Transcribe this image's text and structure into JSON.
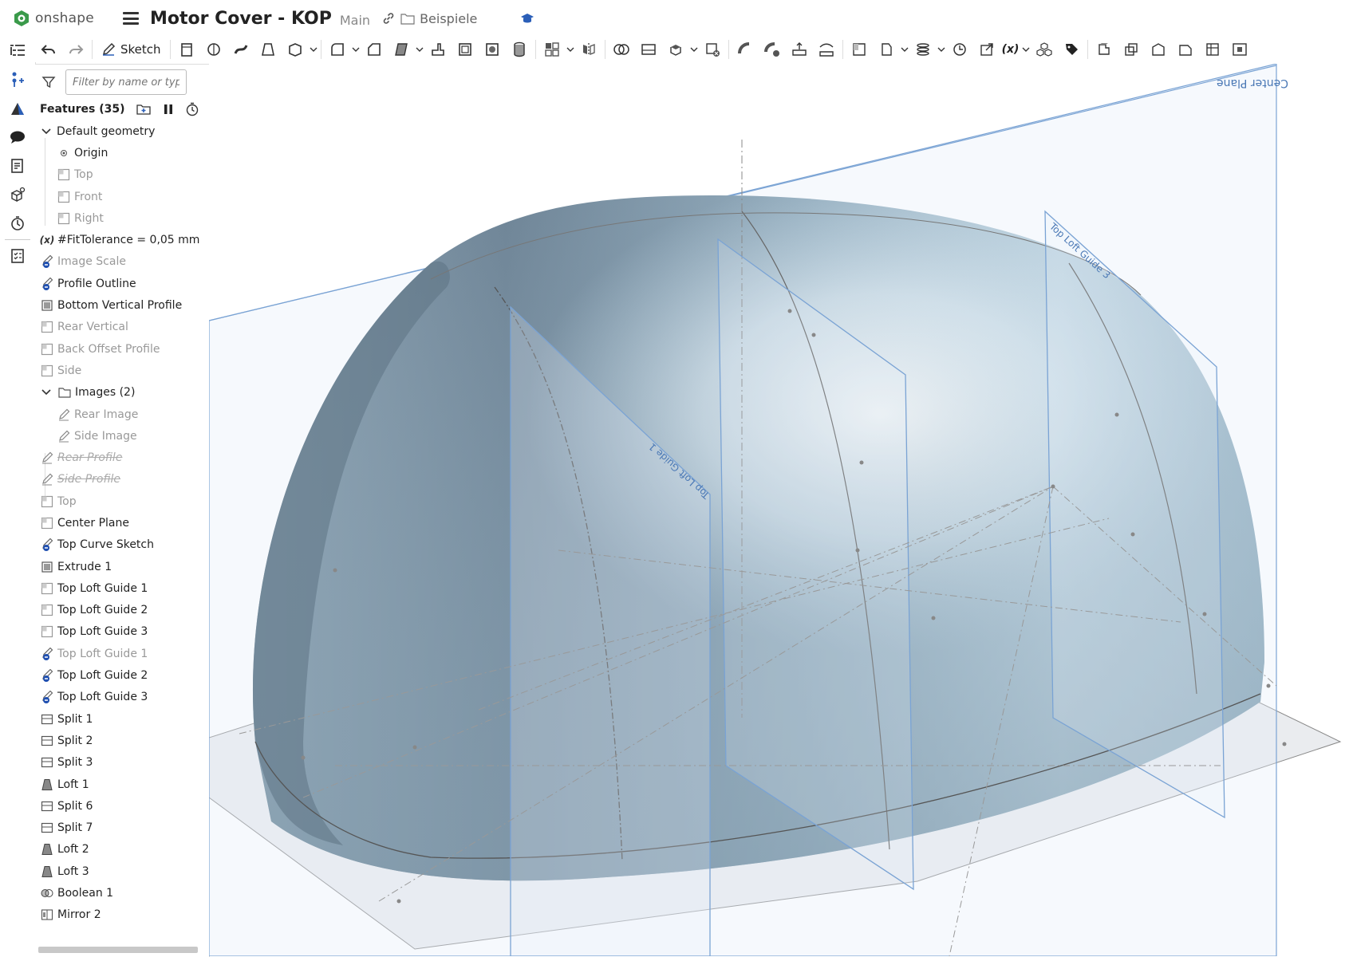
{
  "app": {
    "brand": "onshape",
    "document_title": "Motor Cover - KOP",
    "branch": "Main",
    "folder": "Beispiele"
  },
  "left_sidebar_icons": [
    "feature-list-icon",
    "insert-icon",
    "render-icon",
    "comment-icon",
    "notes-icon",
    "parts-icon",
    "history-icon",
    "properties-icon"
  ],
  "toolbar": {
    "sketch_label": "Sketch",
    "variable_label": "(x)"
  },
  "feature_panel": {
    "filter_placeholder": "Filter by name or type",
    "title": "Features (35)",
    "items": [
      {
        "label": "Default geometry",
        "type": "group",
        "icon": "chevron-down-icon"
      },
      {
        "label": "Origin",
        "type": "origin",
        "sub": true
      },
      {
        "label": "Top",
        "type": "plane",
        "sub": true,
        "grey": true
      },
      {
        "label": "Front",
        "type": "plane",
        "sub": true,
        "grey": true
      },
      {
        "label": "Right",
        "type": "plane",
        "sub": true,
        "grey": true
      },
      {
        "label": "#FitTolerance = 0,05 mm",
        "type": "variable"
      },
      {
        "label": "Image Scale",
        "type": "sketch-err",
        "grey": true
      },
      {
        "label": "Profile Outline",
        "type": "sketch-err"
      },
      {
        "label": "Bottom Vertical Profile",
        "type": "extrude"
      },
      {
        "label": "Rear Vertical",
        "type": "plane",
        "grey": true
      },
      {
        "label": "Back Offset Profile",
        "type": "plane",
        "grey": true
      },
      {
        "label": "Side",
        "type": "plane",
        "grey": true
      },
      {
        "label": "Images (2)",
        "type": "folder"
      },
      {
        "label": "Rear Image",
        "type": "sketch",
        "sub": true,
        "grey": true
      },
      {
        "label": "Side Image",
        "type": "sketch",
        "sub": true,
        "grey": true
      },
      {
        "label": "Rear Profile",
        "type": "sketch",
        "strike": true
      },
      {
        "label": "Side Profile",
        "type": "sketch",
        "strike": true
      },
      {
        "label": "Top",
        "type": "plane",
        "grey": true
      },
      {
        "label": "Center Plane",
        "type": "plane"
      },
      {
        "label": "Top Curve Sketch",
        "type": "sketch-err"
      },
      {
        "label": "Extrude 1",
        "type": "extrude"
      },
      {
        "label": "Top Loft Guide 1",
        "type": "plane"
      },
      {
        "label": "Top Loft Guide 2",
        "type": "plane"
      },
      {
        "label": "Top Loft Guide 3",
        "type": "plane"
      },
      {
        "label": "Top Loft Guide 1",
        "type": "sketch-err",
        "grey": true
      },
      {
        "label": "Top Loft Guide 2",
        "type": "sketch-err"
      },
      {
        "label": "Top Loft Guide 3",
        "type": "sketch-err"
      },
      {
        "label": "Split 1",
        "type": "split"
      },
      {
        "label": "Split 2",
        "type": "split"
      },
      {
        "label": "Split 3",
        "type": "split"
      },
      {
        "label": "Loft 1",
        "type": "loft"
      },
      {
        "label": "Split 6",
        "type": "split"
      },
      {
        "label": "Split 7",
        "type": "split"
      },
      {
        "label": "Loft 2",
        "type": "loft"
      },
      {
        "label": "Loft 3",
        "type": "loft"
      },
      {
        "label": "Boolean 1",
        "type": "boolean"
      },
      {
        "label": "Mirror 2",
        "type": "mirror"
      }
    ]
  },
  "viewport": {
    "plane_labels": {
      "center": "Center Plane",
      "guide1": "Top Loft Guide 1",
      "guide3": "Top Loft Guide 3"
    },
    "colors": {
      "surface": "#9fb4c3",
      "plane_edge": "#7aa3d4",
      "plane_fill": "#dfe9f5"
    }
  }
}
